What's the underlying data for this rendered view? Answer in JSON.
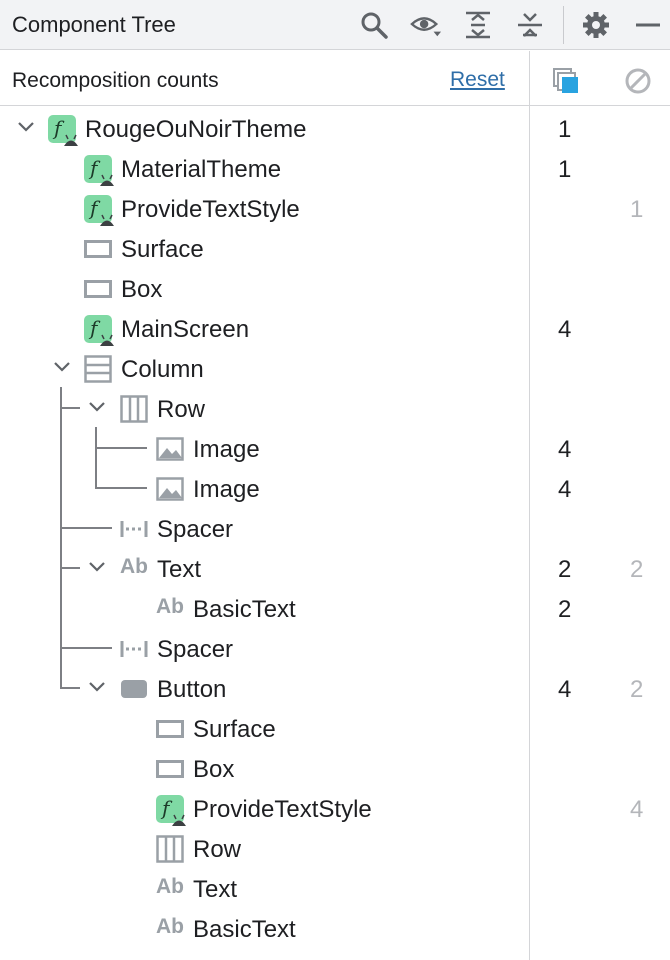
{
  "panel": {
    "title": "Component Tree",
    "toolbar_icons": [
      "search-icon",
      "eye-dropdown-icon",
      "expand-all-icon",
      "collapse-all-icon",
      "gear-icon",
      "minimize-icon"
    ]
  },
  "header": {
    "label": "Recomposition counts",
    "reset": "Reset",
    "columns": [
      "recomposition-count-icon",
      "skip-count-icon"
    ]
  },
  "colors": {
    "accent": "#2f6ea8",
    "composable_badge": "#7fd9a4",
    "icon_gray": "#9aa0a6",
    "count_muted": "#b4b6ba"
  },
  "tree": [
    {
      "name": "RougeOuNoirTheme",
      "icon": "composable-icon",
      "count": "1",
      "skipped": "",
      "expanded": true
    },
    {
      "name": "MaterialTheme",
      "icon": "composable-icon",
      "count": "1",
      "skipped": ""
    },
    {
      "name": "ProvideTextStyle",
      "icon": "composable-icon",
      "count": "",
      "skipped": "1"
    },
    {
      "name": "Surface",
      "icon": "box-outline-icon",
      "count": "",
      "skipped": ""
    },
    {
      "name": "Box",
      "icon": "box-outline-icon",
      "count": "",
      "skipped": ""
    },
    {
      "name": "MainScreen",
      "icon": "composable-icon",
      "count": "4",
      "skipped": ""
    },
    {
      "name": "Column",
      "icon": "column-layout-icon",
      "count": "",
      "skipped": "",
      "expanded": true
    },
    {
      "name": "Row",
      "icon": "row-layout-icon",
      "count": "",
      "skipped": "",
      "expanded": true
    },
    {
      "name": "Image",
      "icon": "image-icon",
      "count": "4",
      "skipped": ""
    },
    {
      "name": "Image",
      "icon": "image-icon",
      "count": "4",
      "skipped": ""
    },
    {
      "name": "Spacer",
      "icon": "spacer-icon",
      "count": "",
      "skipped": ""
    },
    {
      "name": "Text",
      "icon": "text-ab-icon",
      "count": "2",
      "skipped": "2",
      "expanded": true
    },
    {
      "name": "BasicText",
      "icon": "text-ab-icon",
      "count": "2",
      "skipped": ""
    },
    {
      "name": "Spacer",
      "icon": "spacer-icon",
      "count": "",
      "skipped": ""
    },
    {
      "name": "Button",
      "icon": "button-icon",
      "count": "4",
      "skipped": "2",
      "expanded": true
    },
    {
      "name": "Surface",
      "icon": "box-outline-icon",
      "count": "",
      "skipped": ""
    },
    {
      "name": "Box",
      "icon": "box-outline-icon",
      "count": "",
      "skipped": ""
    },
    {
      "name": "ProvideTextStyle",
      "icon": "composable-icon",
      "count": "",
      "skipped": "4"
    },
    {
      "name": "Row",
      "icon": "row-layout-icon",
      "count": "",
      "skipped": ""
    },
    {
      "name": "Text",
      "icon": "text-ab-icon",
      "count": "",
      "skipped": ""
    },
    {
      "name": "BasicText",
      "icon": "text-ab-icon",
      "count": "",
      "skipped": ""
    }
  ]
}
